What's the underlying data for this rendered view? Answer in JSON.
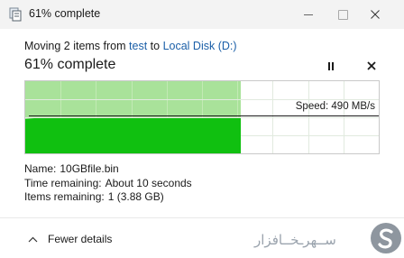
{
  "window": {
    "title": "61% complete",
    "icon": "copy-dialog-icon"
  },
  "operation": {
    "prefix": "Moving 2 items from",
    "source": "test",
    "to_word": "to",
    "destination": "Local Disk (D:)"
  },
  "progress": {
    "headline": "61% complete",
    "percent": 61,
    "pause_icon": "pause-icon",
    "cancel_icon": "close-icon"
  },
  "speed": {
    "label": "Speed: 490 MB/s",
    "value_mb_s": 490
  },
  "details": {
    "name_label": "Name:",
    "name_value": "10GBfile.bin",
    "time_label": "Time remaining:",
    "time_value": "About 10 seconds",
    "items_label": "Items remaining:",
    "items_value": "1 (3.88 GB)"
  },
  "footer": {
    "toggle_label": "Fewer details",
    "toggle_icon": "chevron-up-icon"
  },
  "watermark": {
    "text": "ســهر‌ـخـ‌ـافزار"
  },
  "colors": {
    "progress_fill": "#a9e29a",
    "throughput_area": "#10c010",
    "link": "#1b5fa8"
  }
}
